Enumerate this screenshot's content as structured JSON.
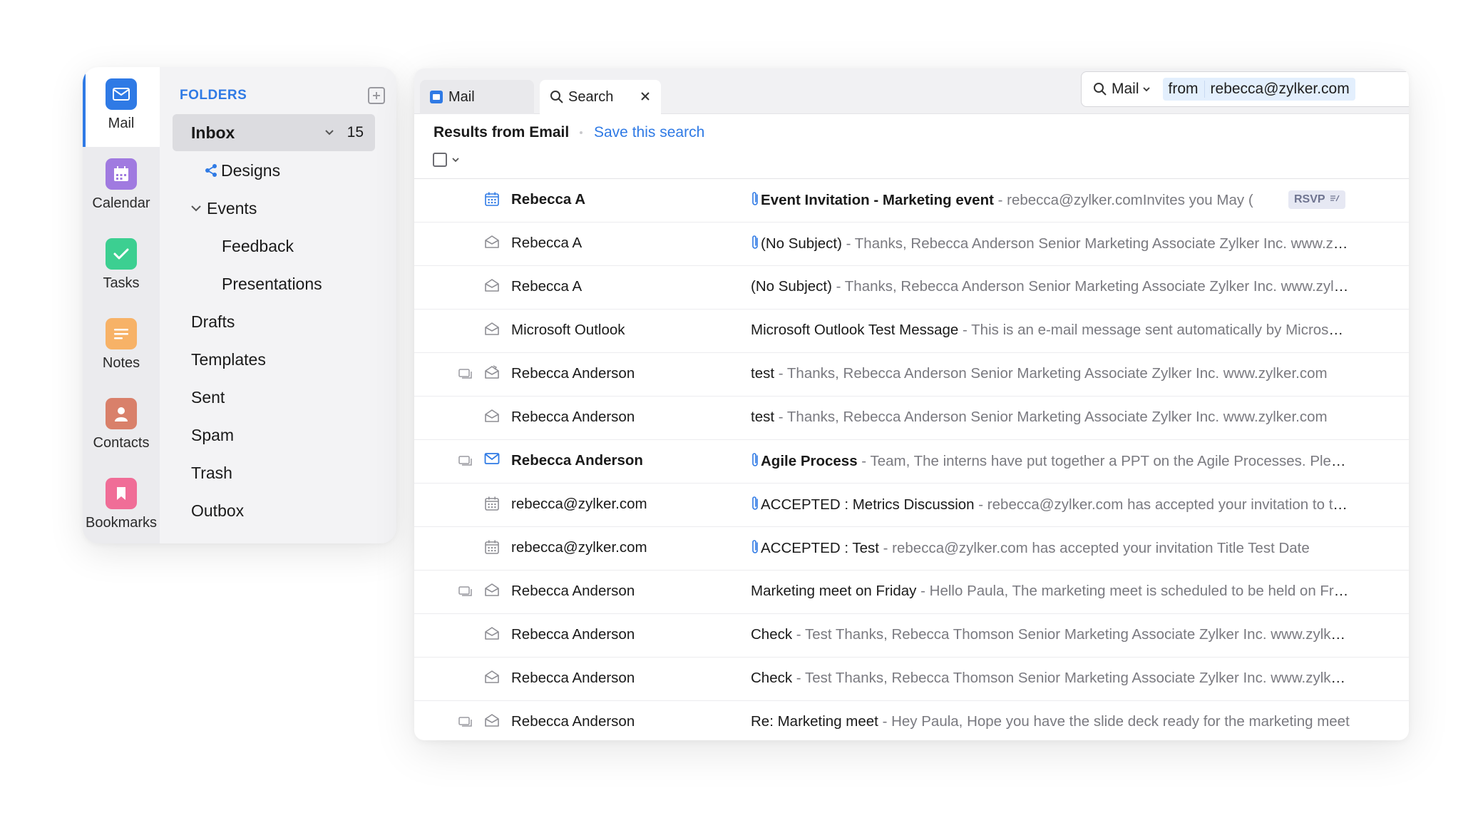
{
  "colors": {
    "accent": "#2f7ae5",
    "mail_app": "#2f7ae5",
    "calendar_app": "#a07ae0",
    "tasks_app": "#3ccf91",
    "notes_app": "#f7b267",
    "contacts_app": "#d9806a",
    "bookmarks_app": "#f06d97"
  },
  "apps": [
    {
      "label": "Mail",
      "icon": "mail-icon"
    },
    {
      "label": "Calendar",
      "icon": "calendar-icon"
    },
    {
      "label": "Tasks",
      "icon": "check-icon"
    },
    {
      "label": "Notes",
      "icon": "notes-icon"
    },
    {
      "label": "Contacts",
      "icon": "person-icon"
    },
    {
      "label": "Bookmarks",
      "icon": "bookmark-icon"
    }
  ],
  "folders": {
    "title": "FOLDERS",
    "inbox": {
      "label": "Inbox",
      "count": "15"
    },
    "designs": "Designs",
    "events": "Events",
    "feedback": "Feedback",
    "presentations": "Presentations",
    "drafts": "Drafts",
    "templates": "Templates",
    "sent": "Sent",
    "spam": "Spam",
    "trash": "Trash",
    "outbox": "Outbox"
  },
  "tabs": {
    "mail": "Mail",
    "search": "Search"
  },
  "search": {
    "scope": "Mail",
    "chip_key": "from",
    "chip_value": "rebecca@zylker.com"
  },
  "results": {
    "title": "Results from Email",
    "save_link": "Save this search"
  },
  "rsvp_label": "RSVP",
  "emails": [
    {
      "sender": "Rebecca A",
      "subject": "Event Invitation - Marketing event",
      "preview": " - rebecca@zylker.comInvites you May (",
      "type": "calendar",
      "bold": true,
      "attachment": true,
      "thread": false,
      "rsvp": true
    },
    {
      "sender": "Rebecca A",
      "subject": "(No Subject)",
      "preview": " - Thanks, Rebecca Anderson Senior Marketing Associate Zylker Inc. www.zylker.com",
      "type": "envelope-open",
      "bold": false,
      "attachment": true,
      "thread": false
    },
    {
      "sender": "Rebecca A",
      "subject": "(No Subject)",
      "preview": " - Thanks, Rebecca Anderson Senior Marketing Associate Zylker Inc. www.zylker.com",
      "type": "envelope-open",
      "bold": false,
      "attachment": false,
      "thread": false
    },
    {
      "sender": "Microsoft Outlook",
      "subject": "Microsoft Outlook Test Message",
      "preview": " - This is an e-mail message sent automatically by Microsoft Outlook",
      "type": "envelope-open",
      "bold": false,
      "attachment": false,
      "thread": false
    },
    {
      "sender": "Rebecca Anderson",
      "subject": "test",
      "preview": " - Thanks, Rebecca Anderson Senior Marketing Associate Zylker Inc. www.zylker.com",
      "type": "envelope-reply",
      "bold": false,
      "attachment": false,
      "thread": true
    },
    {
      "sender": "Rebecca Anderson",
      "subject": "test",
      "preview": " - Thanks, Rebecca Anderson Senior Marketing Associate Zylker Inc. www.zylker.com",
      "type": "envelope-open",
      "bold": false,
      "attachment": false,
      "thread": false
    },
    {
      "sender": "Rebecca Anderson",
      "subject": "Agile Process",
      "preview": " - Team, The interns have put together a PPT on the Agile Processes. Please review",
      "type": "envelope-unread",
      "bold": true,
      "attachment": true,
      "thread": true
    },
    {
      "sender": "rebecca@zylker.com",
      "subject": "ACCEPTED : Metrics Discussion",
      "preview": " - rebecca@zylker.com has accepted your invitation to the event",
      "type": "calendar",
      "bold": false,
      "attachment": true,
      "thread": false
    },
    {
      "sender": "rebecca@zylker.com",
      "subject": "ACCEPTED : Test",
      "preview": " - rebecca@zylker.com has accepted your invitation Title Test Date",
      "type": "calendar",
      "bold": false,
      "attachment": true,
      "thread": false
    },
    {
      "sender": "Rebecca Anderson",
      "subject": "Marketing meet on Friday",
      "preview": " - Hello Paula, The marketing meet is scheduled to be held on Friday",
      "type": "envelope-open",
      "bold": false,
      "attachment": false,
      "thread": true
    },
    {
      "sender": "Rebecca Anderson",
      "subject": "Check",
      "preview": " - Test Thanks, Rebecca Thomson Senior Marketing Associate Zylker Inc. www.zylker.com",
      "type": "envelope-open",
      "bold": false,
      "attachment": false,
      "thread": false
    },
    {
      "sender": "Rebecca Anderson",
      "subject": "Check",
      "preview": " - Test Thanks, Rebecca Thomson Senior Marketing Associate Zylker Inc. www.zylker.com",
      "type": "envelope-open",
      "bold": false,
      "attachment": false,
      "thread": false
    },
    {
      "sender": "Rebecca Anderson",
      "subject": "Re: Marketing meet",
      "preview": " - Hey Paula, Hope you have the slide deck ready for the marketing meet",
      "type": "envelope-open",
      "bold": false,
      "attachment": false,
      "thread": true
    }
  ]
}
